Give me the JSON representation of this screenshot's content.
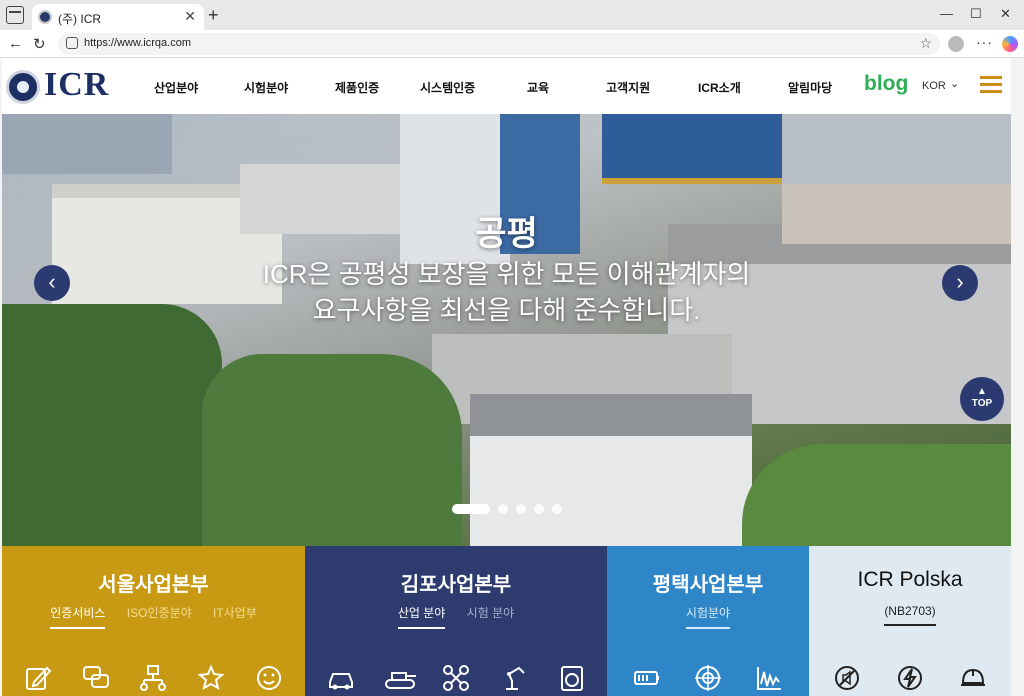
{
  "browser": {
    "tab_title": "(주) ICR",
    "url": "https://www.icrqa.com",
    "new_tab_symbol": "+",
    "close_symbol": "✕"
  },
  "header": {
    "logo_text": "ICR",
    "nav": [
      "산업분야",
      "시험분야",
      "제품인증",
      "시스템인증",
      "교육",
      "고객지원",
      "ICR소개",
      "알림마당"
    ],
    "blog_label": "blog",
    "language": "KOR"
  },
  "hero": {
    "title": "공평",
    "subtitle_line1": "ICR은 공평성 보장을 위한 모든 이해관계자의",
    "subtitle_line2": "요구사항을 최선을 다해 준수합니다.",
    "top_label": "TOP",
    "slide_count": 6,
    "active_slide": 1
  },
  "panels": [
    {
      "title": "서울사업본부",
      "tabs": [
        "인증서비스",
        "ISO인증분야",
        "IT사업부"
      ],
      "active_tab": 0,
      "bg": "#c89a14",
      "icons": [
        "pencil-edit-icon",
        "chat-bubble-icon",
        "network-tree-icon",
        "star-box-icon",
        "smile-face-icon"
      ]
    },
    {
      "title": "김포사업본부",
      "tabs": [
        "산업 분야",
        "시험 분야"
      ],
      "active_tab": 0,
      "bg": "#2d3b6e",
      "icons": [
        "car-icon",
        "tank-icon",
        "drone-icon",
        "robot-arm-icon",
        "washing-machine-icon"
      ]
    },
    {
      "title": "평택사업본부",
      "tabs": [
        "시험분야"
      ],
      "active_tab": 0,
      "bg": "#2e86c9",
      "icons": [
        "battery-icon",
        "target-icon",
        "waveform-chart-icon"
      ]
    },
    {
      "title": "ICR Polska",
      "tabs": [
        "(NB2703)"
      ],
      "active_tab": 0,
      "bg": "#dfe9f2",
      "icons": [
        "no-sound-icon",
        "lightning-icon",
        "helmet-icon"
      ]
    }
  ]
}
